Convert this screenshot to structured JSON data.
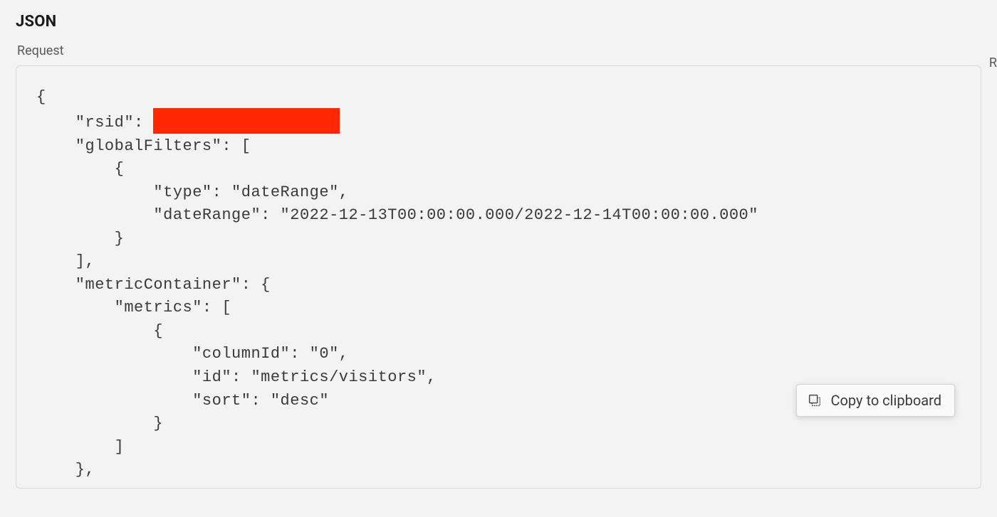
{
  "header": {
    "title": "JSON"
  },
  "tabs": {
    "request_label": "Request",
    "right_hint": "R"
  },
  "copy_button": {
    "label": "Copy to clipboard"
  },
  "code_lines": {
    "l0": "{",
    "l1_pre": "    \"rsid\": ",
    "l2": "    \"globalFilters\": [",
    "l3": "        {",
    "l4": "            \"type\": \"dateRange\",",
    "l5": "            \"dateRange\": \"2022-12-13T00:00:00.000/2022-12-14T00:00:00.000\"",
    "l6": "        }",
    "l7": "    ],",
    "l8": "    \"metricContainer\": {",
    "l9": "        \"metrics\": [",
    "l10": "            {",
    "l11": "                \"columnId\": \"0\",",
    "l12": "                \"id\": \"metrics/visitors\",",
    "l13": "                \"sort\": \"desc\"",
    "l14": "            }",
    "l15": "        ]",
    "l16": "    },"
  }
}
